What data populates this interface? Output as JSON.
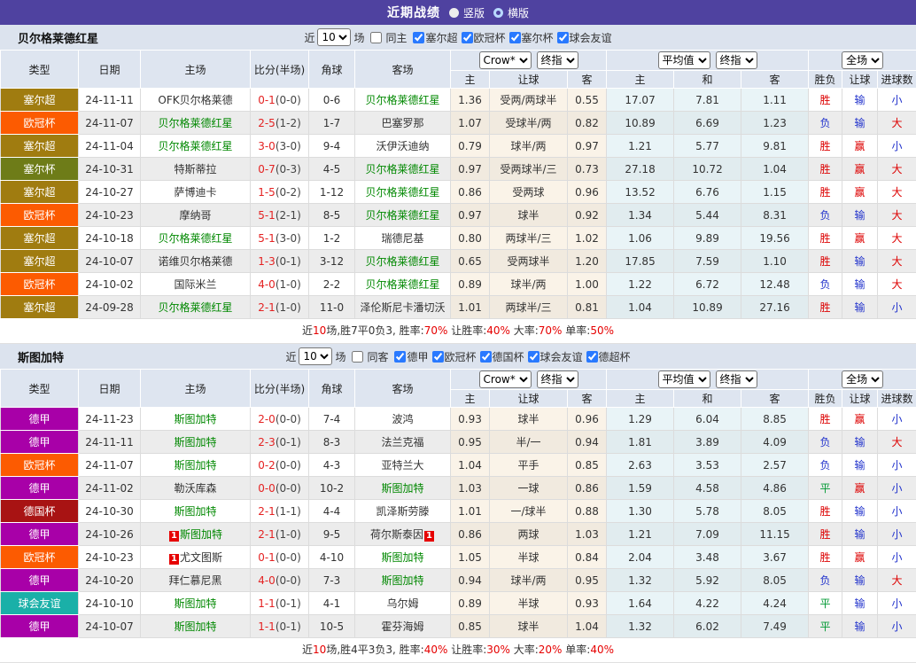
{
  "colors": {
    "accent_purple": "#4f42a0",
    "focal_team_green": "#008800",
    "score_red": "#e42222",
    "win_red": "#dd0000",
    "lose_blue": "#2233cc",
    "draw_green": "#009933",
    "serbia_super": "#a07c10",
    "ucl_orange": "#fc5b01",
    "serbia_cup": "#6e7c18",
    "bundesliga": "#a800a8",
    "german_cup": "#a81313",
    "friendly_teal": "#1ab0a8"
  },
  "topbar": {
    "title": "近期战绩",
    "radio_vertical": "竖版",
    "radio_horizontal": "横版"
  },
  "sections": [
    {
      "team": "贝尔格莱德红星",
      "filter": {
        "near_label": "近",
        "count": "10",
        "games_label": "场",
        "same_label": "同主",
        "leagues": [
          {
            "label": "塞尔超"
          },
          {
            "label": "欧冠杯"
          },
          {
            "label": "塞尔杯"
          },
          {
            "label": "球会友谊"
          }
        ]
      },
      "header": {
        "cols": {
          "type": "类型",
          "date": "日期",
          "home": "主场",
          "score": "比分(半场)",
          "corner": "角球",
          "away": "客场"
        },
        "select_book": "Crow*",
        "select_final1": "终指",
        "select_avg": "平均值",
        "select_final2": "终指",
        "select_scope": "全场",
        "sub": {
          "h": "主",
          "line": "让球",
          "a": "客",
          "ah": "主",
          "ad": "和",
          "aa": "客",
          "wl": "胜负",
          "hc": "让球",
          "goals": "进球数"
        }
      },
      "rows": [
        {
          "type": "塞尔超",
          "type_color": "#a07c10",
          "date": "24-11-11",
          "home_card": "",
          "home": "OFK贝尔格莱德",
          "home_color": "#333333",
          "score": "0-1",
          "half": "(0-0)",
          "corner": "0-6",
          "away": "贝尔格莱德红星",
          "away_color": "#008800",
          "away_card": "",
          "o_home": "1.36",
          "o_line": "受两/两球半",
          "o_away": "0.55",
          "a_home": "17.07",
          "a_draw": "7.81",
          "a_away": "1.11",
          "r_wl": "胜",
          "r_wl_c": "#dd0000",
          "r_h": "输",
          "r_h_c": "#2233cc",
          "r_ou": "小",
          "r_ou_c": "#2233cc"
        },
        {
          "type": "欧冠杯",
          "type_color": "#fc5b01",
          "date": "24-11-07",
          "home_card": "",
          "home": "贝尔格莱德红星",
          "home_color": "#008800",
          "score": "2-5",
          "half": "(1-2)",
          "corner": "1-7",
          "away": "巴塞罗那",
          "away_color": "#333333",
          "away_card": "",
          "o_home": "1.07",
          "o_line": "受球半/两",
          "o_away": "0.82",
          "a_home": "10.89",
          "a_draw": "6.69",
          "a_away": "1.23",
          "r_wl": "负",
          "r_wl_c": "#2233cc",
          "r_h": "输",
          "r_h_c": "#2233cc",
          "r_ou": "大",
          "r_ou_c": "#dd0000"
        },
        {
          "type": "塞尔超",
          "type_color": "#a07c10",
          "date": "24-11-04",
          "home_card": "",
          "home": "贝尔格莱德红星",
          "home_color": "#008800",
          "score": "3-0",
          "half": "(3-0)",
          "corner": "9-4",
          "away": "沃伊沃迪纳",
          "away_color": "#333333",
          "away_card": "",
          "o_home": "0.79",
          "o_line": "球半/两",
          "o_away": "0.97",
          "a_home": "1.21",
          "a_draw": "5.77",
          "a_away": "9.81",
          "r_wl": "胜",
          "r_wl_c": "#dd0000",
          "r_h": "赢",
          "r_h_c": "#dd0000",
          "r_ou": "小",
          "r_ou_c": "#2233cc"
        },
        {
          "type": "塞尔杯",
          "type_color": "#6e7c18",
          "date": "24-10-31",
          "home_card": "",
          "home": "特斯蒂拉",
          "home_color": "#333333",
          "score": "0-7",
          "half": "(0-3)",
          "corner": "4-5",
          "away": "贝尔格莱德红星",
          "away_color": "#008800",
          "away_card": "",
          "o_home": "0.97",
          "o_line": "受两球半/三",
          "o_away": "0.73",
          "a_home": "27.18",
          "a_draw": "10.72",
          "a_away": "1.04",
          "r_wl": "胜",
          "r_wl_c": "#dd0000",
          "r_h": "赢",
          "r_h_c": "#dd0000",
          "r_ou": "大",
          "r_ou_c": "#dd0000"
        },
        {
          "type": "塞尔超",
          "type_color": "#a07c10",
          "date": "24-10-27",
          "home_card": "",
          "home": "萨博迪卡",
          "home_color": "#333333",
          "score": "1-5",
          "half": "(0-2)",
          "corner": "1-12",
          "away": "贝尔格莱德红星",
          "away_color": "#008800",
          "away_card": "",
          "o_home": "0.86",
          "o_line": "受两球",
          "o_away": "0.96",
          "a_home": "13.52",
          "a_draw": "6.76",
          "a_away": "1.15",
          "r_wl": "胜",
          "r_wl_c": "#dd0000",
          "r_h": "赢",
          "r_h_c": "#dd0000",
          "r_ou": "大",
          "r_ou_c": "#dd0000"
        },
        {
          "type": "欧冠杯",
          "type_color": "#fc5b01",
          "date": "24-10-23",
          "home_card": "",
          "home": "摩纳哥",
          "home_color": "#333333",
          "score": "5-1",
          "half": "(2-1)",
          "corner": "8-5",
          "away": "贝尔格莱德红星",
          "away_color": "#008800",
          "away_card": "",
          "o_home": "0.97",
          "o_line": "球半",
          "o_away": "0.92",
          "a_home": "1.34",
          "a_draw": "5.44",
          "a_away": "8.31",
          "r_wl": "负",
          "r_wl_c": "#2233cc",
          "r_h": "输",
          "r_h_c": "#2233cc",
          "r_ou": "大",
          "r_ou_c": "#dd0000"
        },
        {
          "type": "塞尔超",
          "type_color": "#a07c10",
          "date": "24-10-18",
          "home_card": "",
          "home": "贝尔格莱德红星",
          "home_color": "#008800",
          "score": "5-1",
          "half": "(3-0)",
          "corner": "1-2",
          "away": "瑞德尼基",
          "away_color": "#333333",
          "away_card": "",
          "o_home": "0.80",
          "o_line": "两球半/三",
          "o_away": "1.02",
          "a_home": "1.06",
          "a_draw": "9.89",
          "a_away": "19.56",
          "r_wl": "胜",
          "r_wl_c": "#dd0000",
          "r_h": "赢",
          "r_h_c": "#dd0000",
          "r_ou": "大",
          "r_ou_c": "#dd0000"
        },
        {
          "type": "塞尔超",
          "type_color": "#a07c10",
          "date": "24-10-07",
          "home_card": "",
          "home": "诺维贝尔格莱德",
          "home_color": "#333333",
          "score": "1-3",
          "half": "(0-1)",
          "corner": "3-12",
          "away": "贝尔格莱德红星",
          "away_color": "#008800",
          "away_card": "",
          "o_home": "0.65",
          "o_line": "受两球半",
          "o_away": "1.20",
          "a_home": "17.85",
          "a_draw": "7.59",
          "a_away": "1.10",
          "r_wl": "胜",
          "r_wl_c": "#dd0000",
          "r_h": "输",
          "r_h_c": "#2233cc",
          "r_ou": "大",
          "r_ou_c": "#dd0000"
        },
        {
          "type": "欧冠杯",
          "type_color": "#fc5b01",
          "date": "24-10-02",
          "home_card": "",
          "home": "国际米兰",
          "home_color": "#333333",
          "score": "4-0",
          "half": "(1-0)",
          "corner": "2-2",
          "away": "贝尔格莱德红星",
          "away_color": "#008800",
          "away_card": "",
          "o_home": "0.89",
          "o_line": "球半/两",
          "o_away": "1.00",
          "a_home": "1.22",
          "a_draw": "6.72",
          "a_away": "12.48",
          "r_wl": "负",
          "r_wl_c": "#2233cc",
          "r_h": "输",
          "r_h_c": "#2233cc",
          "r_ou": "大",
          "r_ou_c": "#dd0000"
        },
        {
          "type": "塞尔超",
          "type_color": "#a07c10",
          "date": "24-09-28",
          "home_card": "",
          "home": "贝尔格莱德红星",
          "home_color": "#008800",
          "score": "2-1",
          "half": "(1-0)",
          "corner": "11-0",
          "away": "泽伦斯尼卡潘切沃",
          "away_color": "#333333",
          "away_card": "",
          "o_home": "1.01",
          "o_line": "两球半/三",
          "o_away": "0.81",
          "a_home": "1.04",
          "a_draw": "10.89",
          "a_away": "27.16",
          "r_wl": "胜",
          "r_wl_c": "#dd0000",
          "r_h": "输",
          "r_h_c": "#2233cc",
          "r_ou": "小",
          "r_ou_c": "#2233cc"
        }
      ],
      "summary": {
        "t1": "近",
        "r1": "10",
        "t2": "场,胜7平0负3, 胜率:",
        "r2": "70%",
        "t3": " 让胜率:",
        "r3": "40%",
        "t4": " 大率:",
        "r4": "70%",
        "t5": " 单率:",
        "r5": "50%"
      }
    },
    {
      "team": "斯图加特",
      "filter": {
        "near_label": "近",
        "count": "10",
        "games_label": "场",
        "same_label": "同客",
        "leagues": [
          {
            "label": "德甲"
          },
          {
            "label": "欧冠杯"
          },
          {
            "label": "德国杯"
          },
          {
            "label": "球会友谊"
          },
          {
            "label": "德超杯"
          }
        ]
      },
      "header": {
        "cols": {
          "type": "类型",
          "date": "日期",
          "home": "主场",
          "score": "比分(半场)",
          "corner": "角球",
          "away": "客场"
        },
        "select_book": "Crow*",
        "select_final1": "终指",
        "select_avg": "平均值",
        "select_final2": "终指",
        "select_scope": "全场",
        "sub": {
          "h": "主",
          "line": "让球",
          "a": "客",
          "ah": "主",
          "ad": "和",
          "aa": "客",
          "wl": "胜负",
          "hc": "让球",
          "goals": "进球数"
        }
      },
      "rows": [
        {
          "type": "德甲",
          "type_color": "#a800a8",
          "date": "24-11-23",
          "home_card": "",
          "home": "斯图加特",
          "home_color": "#008800",
          "score": "2-0",
          "half": "(0-0)",
          "corner": "7-4",
          "away": "波鸿",
          "away_color": "#333333",
          "away_card": "",
          "o_home": "0.93",
          "o_line": "球半",
          "o_away": "0.96",
          "a_home": "1.29",
          "a_draw": "6.04",
          "a_away": "8.85",
          "r_wl": "胜",
          "r_wl_c": "#dd0000",
          "r_h": "赢",
          "r_h_c": "#dd0000",
          "r_ou": "小",
          "r_ou_c": "#2233cc"
        },
        {
          "type": "德甲",
          "type_color": "#a800a8",
          "date": "24-11-11",
          "home_card": "",
          "home": "斯图加特",
          "home_color": "#008800",
          "score": "2-3",
          "half": "(0-1)",
          "corner": "8-3",
          "away": "法兰克福",
          "away_color": "#333333",
          "away_card": "",
          "o_home": "0.95",
          "o_line": "半/一",
          "o_away": "0.94",
          "a_home": "1.81",
          "a_draw": "3.89",
          "a_away": "4.09",
          "r_wl": "负",
          "r_wl_c": "#2233cc",
          "r_h": "输",
          "r_h_c": "#2233cc",
          "r_ou": "大",
          "r_ou_c": "#dd0000"
        },
        {
          "type": "欧冠杯",
          "type_color": "#fc5b01",
          "date": "24-11-07",
          "home_card": "",
          "home": "斯图加特",
          "home_color": "#008800",
          "score": "0-2",
          "half": "(0-0)",
          "corner": "4-3",
          "away": "亚特兰大",
          "away_color": "#333333",
          "away_card": "",
          "o_home": "1.04",
          "o_line": "平手",
          "o_away": "0.85",
          "a_home": "2.63",
          "a_draw": "3.53",
          "a_away": "2.57",
          "r_wl": "负",
          "r_wl_c": "#2233cc",
          "r_h": "输",
          "r_h_c": "#2233cc",
          "r_ou": "小",
          "r_ou_c": "#2233cc"
        },
        {
          "type": "德甲",
          "type_color": "#a800a8",
          "date": "24-11-02",
          "home_card": "",
          "home": "勒沃库森",
          "home_color": "#333333",
          "score": "0-0",
          "half": "(0-0)",
          "corner": "10-2",
          "away": "斯图加特",
          "away_color": "#008800",
          "away_card": "",
          "o_home": "1.03",
          "o_line": "一球",
          "o_away": "0.86",
          "a_home": "1.59",
          "a_draw": "4.58",
          "a_away": "4.86",
          "r_wl": "平",
          "r_wl_c": "#009933",
          "r_h": "赢",
          "r_h_c": "#dd0000",
          "r_ou": "小",
          "r_ou_c": "#2233cc"
        },
        {
          "type": "德国杯",
          "type_color": "#a81313",
          "date": "24-10-30",
          "home_card": "",
          "home": "斯图加特",
          "home_color": "#008800",
          "score": "2-1",
          "half": "(1-1)",
          "corner": "4-4",
          "away": "凯泽斯劳滕",
          "away_color": "#333333",
          "away_card": "",
          "o_home": "1.01",
          "o_line": "一/球半",
          "o_away": "0.88",
          "a_home": "1.30",
          "a_draw": "5.78",
          "a_away": "8.05",
          "r_wl": "胜",
          "r_wl_c": "#dd0000",
          "r_h": "输",
          "r_h_c": "#2233cc",
          "r_ou": "小",
          "r_ou_c": "#2233cc"
        },
        {
          "type": "德甲",
          "type_color": "#a800a8",
          "date": "24-10-26",
          "home_card": "1",
          "home": "斯图加特",
          "home_color": "#008800",
          "score": "2-1",
          "half": "(1-0)",
          "corner": "9-5",
          "away": "荷尔斯泰因",
          "away_color": "#333333",
          "away_card": "1",
          "o_home": "0.86",
          "o_line": "两球",
          "o_away": "1.03",
          "a_home": "1.21",
          "a_draw": "7.09",
          "a_away": "11.15",
          "r_wl": "胜",
          "r_wl_c": "#dd0000",
          "r_h": "输",
          "r_h_c": "#2233cc",
          "r_ou": "小",
          "r_ou_c": "#2233cc"
        },
        {
          "type": "欧冠杯",
          "type_color": "#fc5b01",
          "date": "24-10-23",
          "home_card": "1",
          "home": "尤文图斯",
          "home_color": "#333333",
          "score": "0-1",
          "half": "(0-0)",
          "corner": "4-10",
          "away": "斯图加特",
          "away_color": "#008800",
          "away_card": "",
          "o_home": "1.05",
          "o_line": "半球",
          "o_away": "0.84",
          "a_home": "2.04",
          "a_draw": "3.48",
          "a_away": "3.67",
          "r_wl": "胜",
          "r_wl_c": "#dd0000",
          "r_h": "赢",
          "r_h_c": "#dd0000",
          "r_ou": "小",
          "r_ou_c": "#2233cc"
        },
        {
          "type": "德甲",
          "type_color": "#a800a8",
          "date": "24-10-20",
          "home_card": "",
          "home": "拜仁慕尼黑",
          "home_color": "#333333",
          "score": "4-0",
          "half": "(0-0)",
          "corner": "7-3",
          "away": "斯图加特",
          "away_color": "#008800",
          "away_card": "",
          "o_home": "0.94",
          "o_line": "球半/两",
          "o_away": "0.95",
          "a_home": "1.32",
          "a_draw": "5.92",
          "a_away": "8.05",
          "r_wl": "负",
          "r_wl_c": "#2233cc",
          "r_h": "输",
          "r_h_c": "#2233cc",
          "r_ou": "大",
          "r_ou_c": "#dd0000"
        },
        {
          "type": "球会友谊",
          "type_color": "#1ab0a8",
          "date": "24-10-10",
          "home_card": "",
          "home": "斯图加特",
          "home_color": "#008800",
          "score": "1-1",
          "half": "(0-1)",
          "corner": "4-1",
          "away": "乌尔姆",
          "away_color": "#333333",
          "away_card": "",
          "o_home": "0.89",
          "o_line": "半球",
          "o_away": "0.93",
          "a_home": "1.64",
          "a_draw": "4.22",
          "a_away": "4.24",
          "r_wl": "平",
          "r_wl_c": "#009933",
          "r_h": "输",
          "r_h_c": "#2233cc",
          "r_ou": "小",
          "r_ou_c": "#2233cc"
        },
        {
          "type": "德甲",
          "type_color": "#a800a8",
          "date": "24-10-07",
          "home_card": "",
          "home": "斯图加特",
          "home_color": "#008800",
          "score": "1-1",
          "half": "(0-1)",
          "corner": "10-5",
          "away": "霍芬海姆",
          "away_color": "#333333",
          "away_card": "",
          "o_home": "0.85",
          "o_line": "球半",
          "o_away": "1.04",
          "a_home": "1.32",
          "a_draw": "6.02",
          "a_away": "7.49",
          "r_wl": "平",
          "r_wl_c": "#009933",
          "r_h": "输",
          "r_h_c": "#2233cc",
          "r_ou": "小",
          "r_ou_c": "#2233cc"
        }
      ],
      "summary": {
        "t1": "近",
        "r1": "10",
        "t2": "场,胜4平3负3, 胜率:",
        "r2": "40%",
        "t3": " 让胜率:",
        "r3": "30%",
        "t4": " 大率:",
        "r4": "20%",
        "t5": " 单率:",
        "r5": "40%"
      }
    }
  ]
}
